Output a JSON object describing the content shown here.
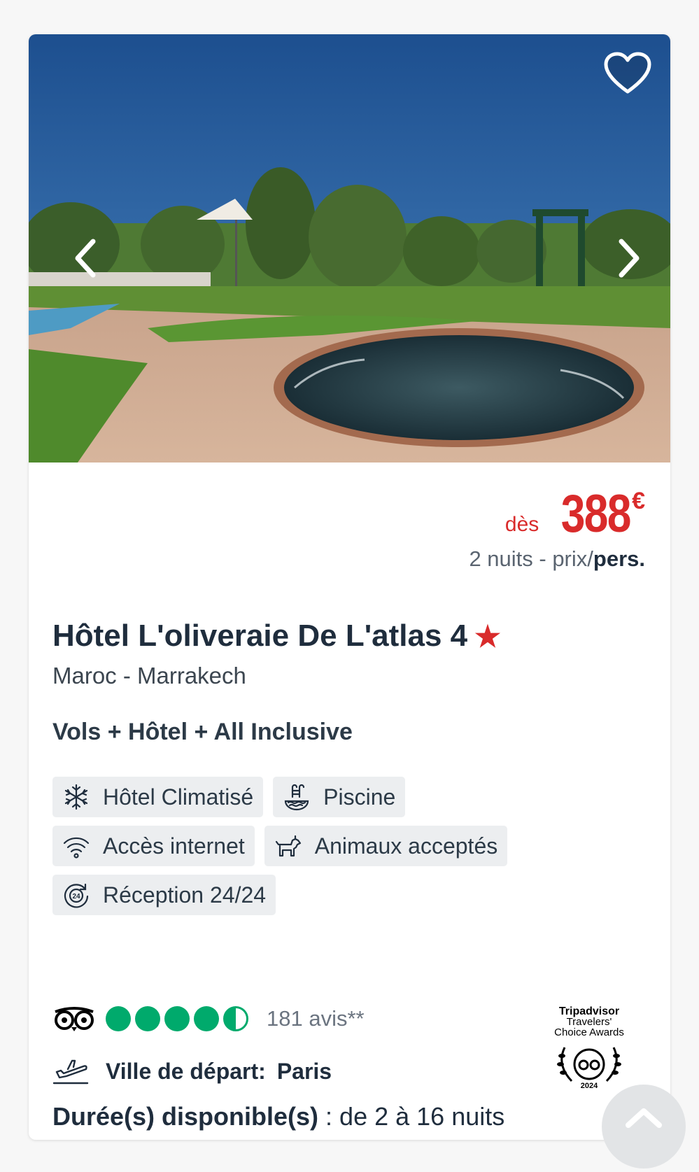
{
  "hotel": {
    "name": "Hôtel L'oliveraie De L'atlas 4",
    "stars_glyph": "★",
    "location": "Maroc - Marrakech",
    "formula": "Vols + Hôtel + All Inclusive"
  },
  "price": {
    "prefix": "dès",
    "amount": "388",
    "currency": "€",
    "details_prefix": "2 nuits - prix/",
    "details_bold": "pers."
  },
  "amenities": [
    {
      "label": "Hôtel Climatisé",
      "icon": "snowflake-icon"
    },
    {
      "label": "Piscine",
      "icon": "pool-icon"
    },
    {
      "label": "Accès internet",
      "icon": "wifi-icon"
    },
    {
      "label": "Animaux acceptés",
      "icon": "pet-icon"
    },
    {
      "label": "Réception 24/24",
      "icon": "reception-24-icon"
    }
  ],
  "rating": {
    "bubbles": 4.5,
    "max": 5,
    "reviews_text": "181 avis**"
  },
  "departure": {
    "label": "Ville de départ:",
    "city": "Paris"
  },
  "duration": {
    "label": "Durée(s) disponible(s)",
    "value": " : de 2 à 16 nuits"
  },
  "award": {
    "line1": "Tripadvisor",
    "line2": "Travelers'",
    "line3": "Choice Awards",
    "year": "2024"
  },
  "colors": {
    "accent": "#d92b2b",
    "tripadvisor_green": "#00aa6c",
    "chip_bg": "#eceef0"
  }
}
